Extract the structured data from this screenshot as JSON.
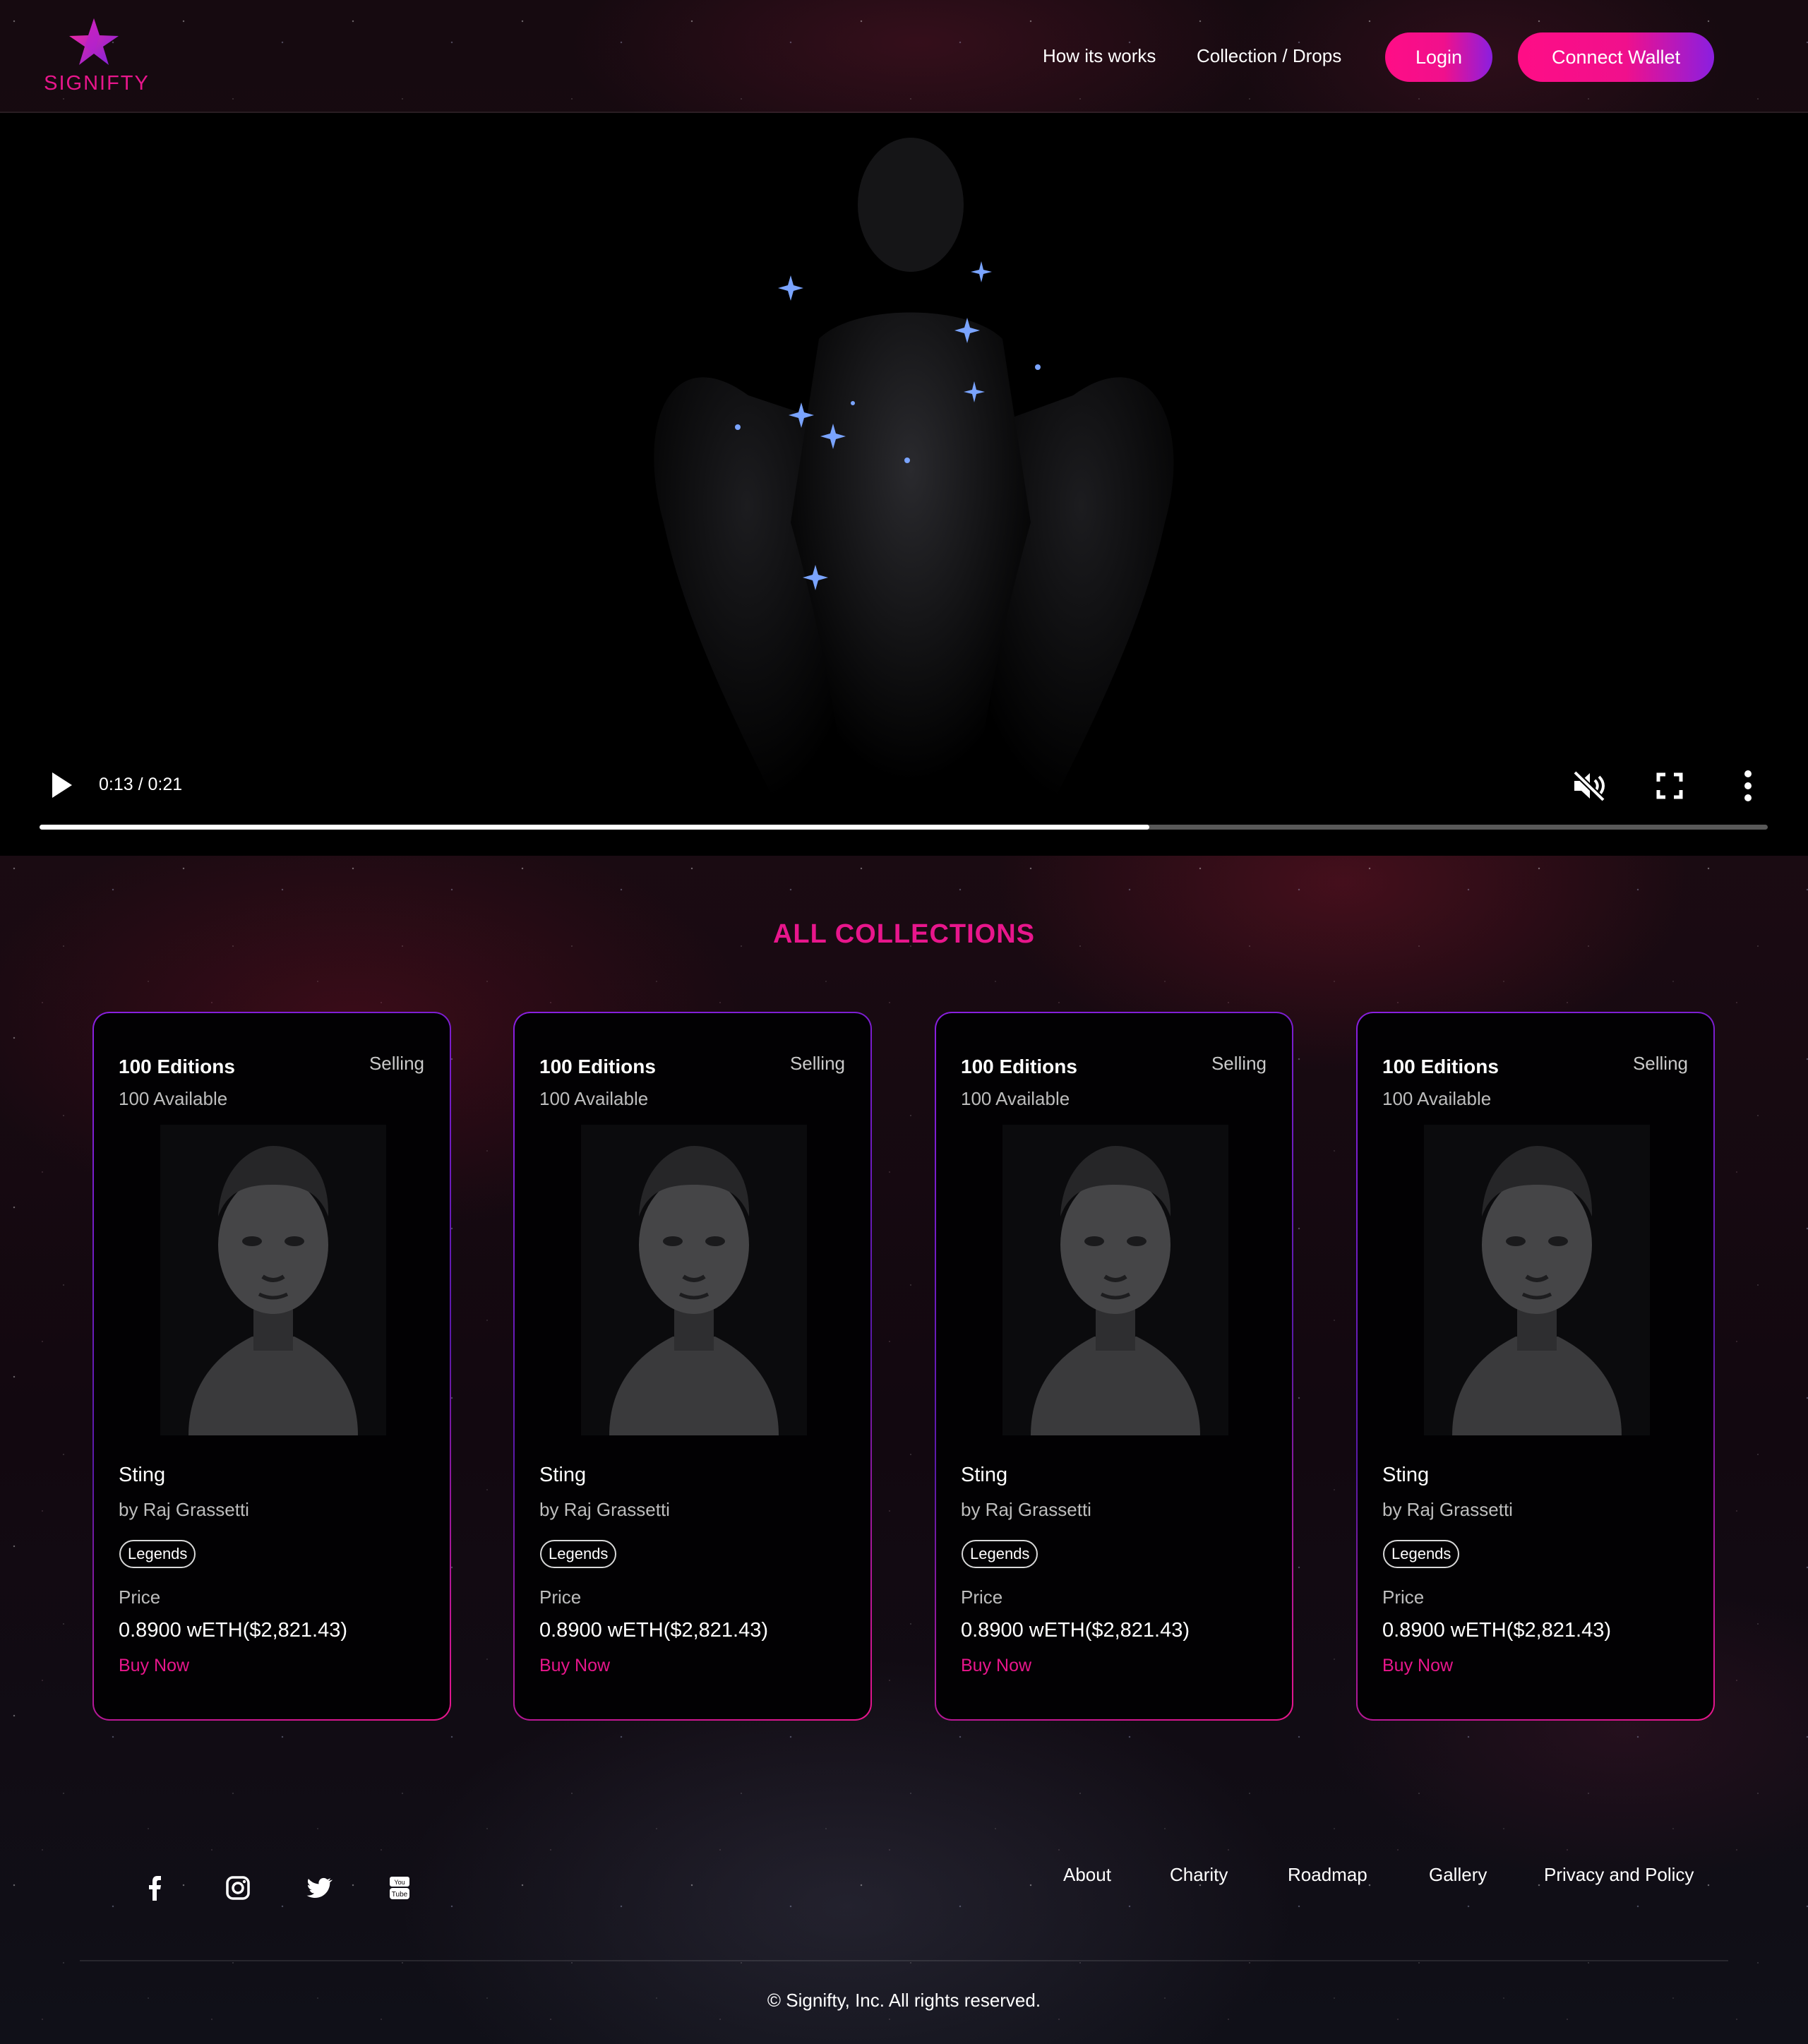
{
  "brand": {
    "name": "SIGNIFTY",
    "accent": "#e8168c",
    "accent_secondary": "#8a1fe0"
  },
  "nav": {
    "links": [
      "How its works",
      "Collection / Drops"
    ],
    "login_label": "Login",
    "connect_label": "Connect Wallet"
  },
  "video": {
    "time_label": "0:13 / 0:21",
    "progress": 0.642,
    "muted": true,
    "icons": [
      "play-icon",
      "volume-muted-icon",
      "fullscreen-icon",
      "more-vertical-icon"
    ]
  },
  "collections": {
    "title": "ALL COLLECTIONS",
    "cards": [
      {
        "editions": "100 Editions",
        "status": "Selling",
        "available": "100 Available",
        "name": "Sting",
        "artist": "by Raj Grassetti",
        "tag": "Legends",
        "price_label": "Price",
        "price": "0.8900 wETH($2,821.43)",
        "cta": "Buy Now"
      },
      {
        "editions": "100 Editions",
        "status": "Selling",
        "available": "100 Available",
        "name": "Sting",
        "artist": "by Raj Grassetti",
        "tag": "Legends",
        "price_label": "Price",
        "price": "0.8900 wETH($2,821.43)",
        "cta": "Buy Now"
      },
      {
        "editions": "100 Editions",
        "status": "Selling",
        "available": "100 Available",
        "name": "Sting",
        "artist": "by Raj Grassetti",
        "tag": "Legends",
        "price_label": "Price",
        "price": "0.8900 wETH($2,821.43)",
        "cta": "Buy Now"
      },
      {
        "editions": "100 Editions",
        "status": "Selling",
        "available": "100 Available",
        "name": "Sting",
        "artist": "by Raj Grassetti",
        "tag": "Legends",
        "price_label": "Price",
        "price": "0.8900 wETH($2,821.43)",
        "cta": "Buy Now"
      }
    ]
  },
  "footer": {
    "social_icons": [
      "facebook-icon",
      "instagram-icon",
      "twitter-icon",
      "youtube-icon"
    ],
    "links": [
      "About",
      "Charity",
      "Roadmap",
      "Gallery",
      "Privacy and Policy"
    ],
    "copyright": "© Signifty, Inc. All rights reserved."
  }
}
